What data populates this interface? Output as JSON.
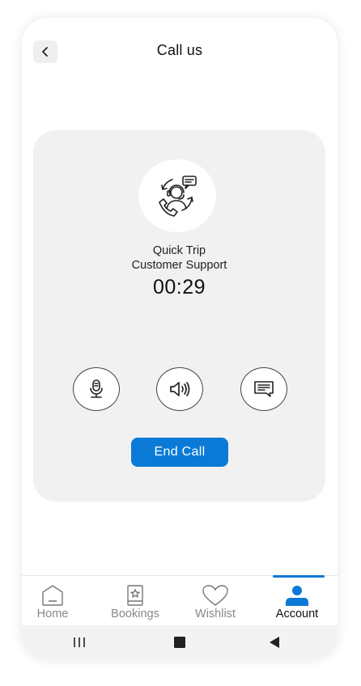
{
  "header": {
    "title": "Call us"
  },
  "call": {
    "name_line1": "Quick Trip",
    "name_line2": "Customer Support",
    "timer": "00:29",
    "end_label": "End Call",
    "controls": [
      "microphone-icon",
      "speaker-icon",
      "message-icon"
    ]
  },
  "nav": {
    "items": [
      {
        "label": "Home",
        "icon": "home-icon"
      },
      {
        "label": "Bookings",
        "icon": "bookings-icon"
      },
      {
        "label": "Wishlist",
        "icon": "heart-icon"
      },
      {
        "label": "Account",
        "icon": "account-icon"
      }
    ],
    "active": "Account"
  },
  "colors": {
    "accent": "#0a7ad6",
    "card": "#f1f1f1"
  }
}
